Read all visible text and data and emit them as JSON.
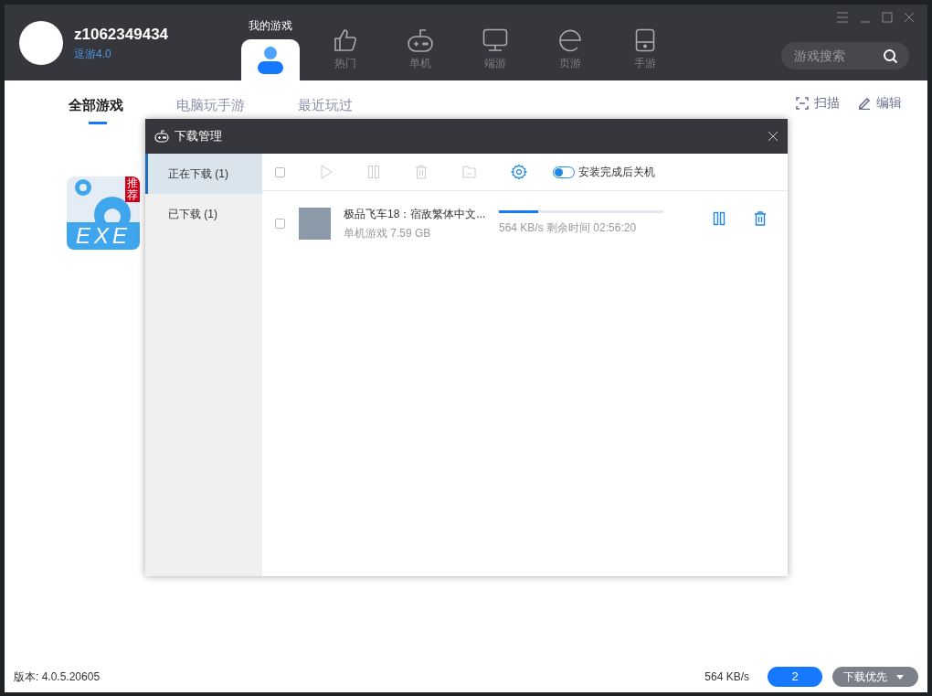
{
  "user": {
    "name": "z1062349434",
    "subtitle": "逗游4.0"
  },
  "nav_tabs": [
    {
      "label": "我的游戏",
      "kind": "person",
      "selected": true
    },
    {
      "label": "热门",
      "kind": "thumb",
      "selected": false
    },
    {
      "label": "单机",
      "kind": "gamepad",
      "selected": false
    },
    {
      "label": "端游",
      "kind": "monitor",
      "selected": false
    },
    {
      "label": "页游",
      "kind": "web",
      "selected": false
    },
    {
      "label": "手游",
      "kind": "phone",
      "selected": false
    }
  ],
  "search": {
    "placeholder": "游戏搜索"
  },
  "sub_tabs": [
    {
      "label": "全部游戏",
      "selected": true
    },
    {
      "label": "电脑玩手游",
      "selected": false
    },
    {
      "label": "最近玩过",
      "selected": false
    }
  ],
  "actions": [
    {
      "label": "扫描",
      "kind": "scan"
    },
    {
      "label": "编辑",
      "kind": "edit"
    }
  ],
  "games": [
    {
      "icon_text": "EXE",
      "badge": "推荐"
    }
  ],
  "dialog": {
    "title": "下载管理",
    "sidebar": [
      {
        "label": "正在下载 (1)",
        "selected": true
      },
      {
        "label": "已下载 (1)",
        "selected": false
      }
    ],
    "select_all": {
      "checked": false
    },
    "shutdown_toggle": {
      "label": "安装完成后关机",
      "on": false
    },
    "downloads": [
      {
        "name": "极品飞车18：宿敌繁体中文...",
        "info": "单机游戏 7.59 GB",
        "level": 0.24,
        "status": "564 KB/s 剩余时间 02:56:20",
        "checked": false
      }
    ]
  },
  "footer": {
    "version": "版本: 4.0.5.20605",
    "speed": "564 KB/s",
    "count": "2",
    "priority": "下载优先"
  }
}
